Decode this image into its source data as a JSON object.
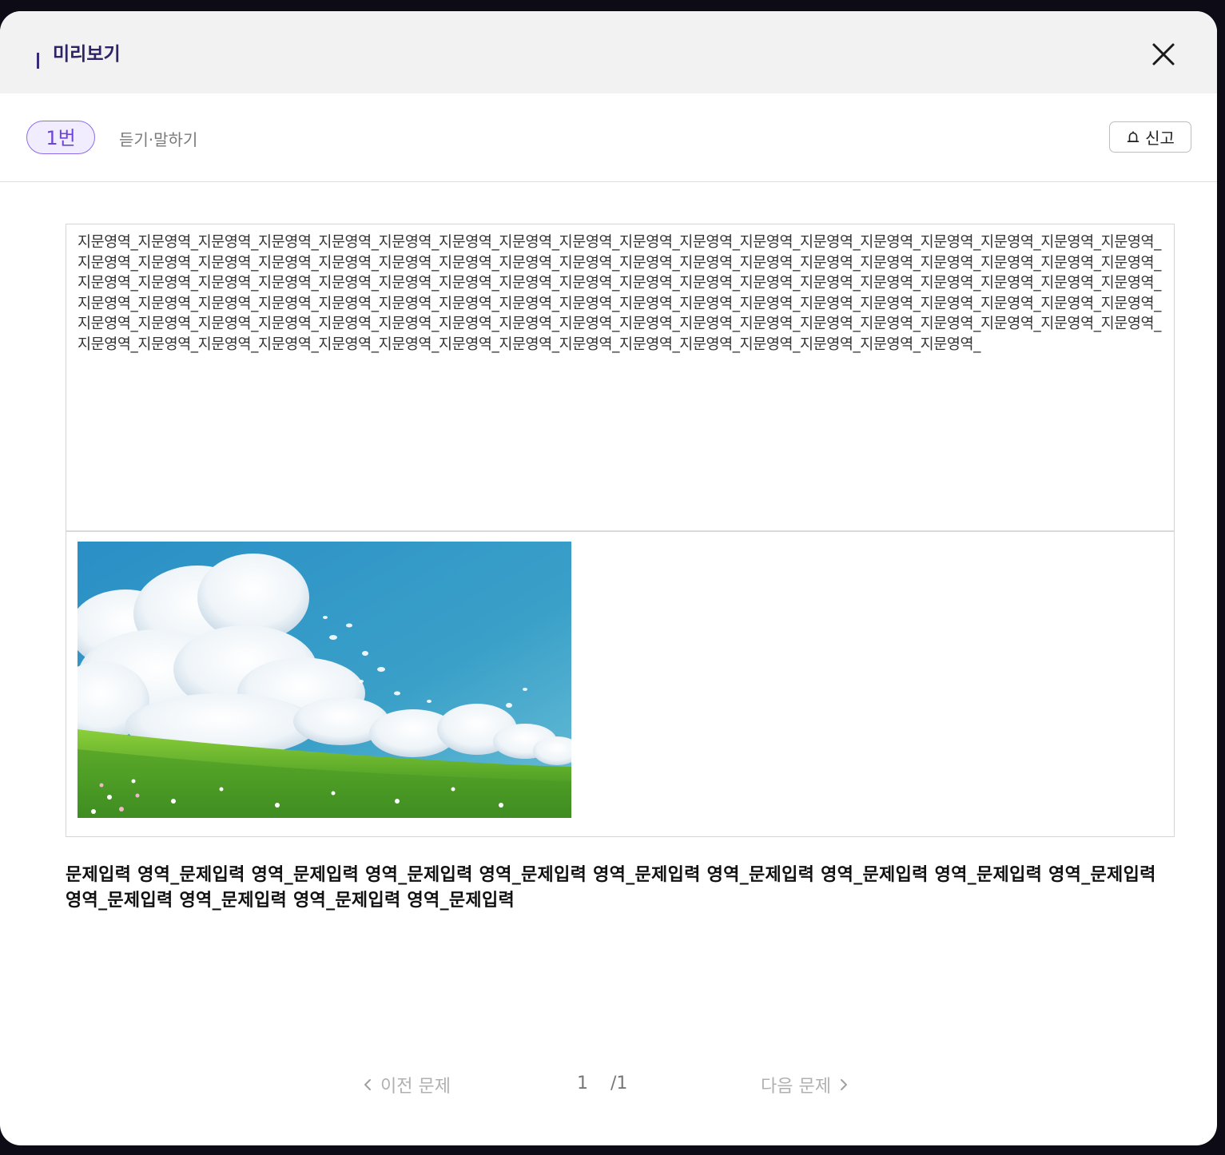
{
  "header": {
    "title": "미리보기",
    "close_icon": "close-icon"
  },
  "toolbar": {
    "question_number": "1번",
    "question_type": "듣기·말하기",
    "report_label": "신고",
    "report_icon": "bell-icon"
  },
  "passage": {
    "text": "지문영역_지문영역_지문영역_지문영역_지문영역_지문영역_지문영역_지문영역_지문영역_지문영역_지문영역_지문영역_지문영역_지문영역_지문영역_지문영역_지문영역_지문영역_지문영역_지문영역_지문영역_지문영역_지문영역_지문영역_지문영역_지문영역_지문영역_지문영역_지문영역_지문영역_지문영역_지문영역_지문영역_지문영역_지문영역_지문영역_지문영역_지문영역_지문영역_지문영역_지문영역_지문영역_지문영역_지문영역_지문영역_지문영역_지문영역_지문영역_지문영역_지문영역_지문영역_지문영역_지문영역_지문영역_지문영역_지문영역_지문영역_지문영역_지문영역_지문영역_지문영역_지문영역_지문영역_지문영역_지문영역_지문영역_지문영역_지문영역_지문영역_지문영역_지문영역_지문영역_지문영역_지문영역_지문영역_지문영역_지문영역_지문영역_지문영역_지문영역_지문영역_지문영역_지문영역_지문영역_지문영역_지문영역_지문영역_지문영역_지문영역_지문영역_지문영역_지문영역_지문영역_지문영역_지문영역_지문영역_지문영역_지문영역_지문영역_지문영역_지문영역_지문영역_지문영역_지문영역_지문영역_",
    "image": "sky-meadow-illustration"
  },
  "question": {
    "text": "문제입력 영역_문제입력 영역_문제입력 영역_문제입력 영역_문제입력 영역_문제입력 영역_문제입력 영역_문제입력 영역_문제입력 영역_문제입력 영역_문제입력 영역_문제입력 영역_문제입력 영역_문제입력"
  },
  "pager": {
    "prev_label": "이전 문제",
    "next_label": "다음 문제",
    "current_page": "1",
    "total_pages": "/1",
    "prev_icon": "chevron-left-icon",
    "next_icon": "chevron-right-icon"
  },
  "colors": {
    "accent": "#6c45d8",
    "title": "#2d2366",
    "header_bg": "#f2f2f2"
  }
}
